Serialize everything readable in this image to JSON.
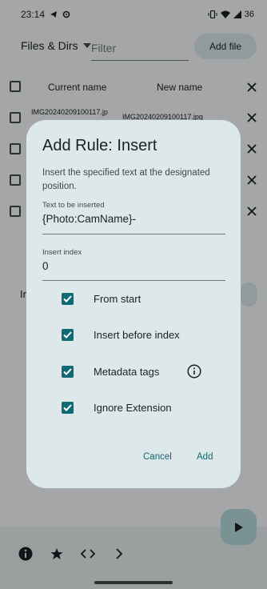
{
  "status_bar": {
    "time": "23:14",
    "battery": "36"
  },
  "toolbar": {
    "files_dropdown": "Files & Dirs",
    "filter_placeholder": "Filter",
    "add_file": "Add file"
  },
  "table": {
    "col_current": "Current name",
    "col_new": "New name",
    "rows": [
      {
        "current": "IMG20240209100117.jp",
        "new": "IMG20240209100117.jpg"
      }
    ]
  },
  "partial_text": "In",
  "dialog": {
    "title": "Add Rule: Insert",
    "description": "Insert the specified text at the designated position.",
    "text_field": {
      "label": "Text to be inserted",
      "value": "{Photo:CamName}-"
    },
    "index_field": {
      "label": "Insert index",
      "value": "0"
    },
    "options": [
      {
        "label": "From start",
        "checked": true
      },
      {
        "label": "Insert before index",
        "checked": true
      },
      {
        "label": "Metadata tags",
        "checked": true
      },
      {
        "label": "Ignore Extension",
        "checked": true
      }
    ],
    "cancel": "Cancel",
    "add": "Add"
  },
  "colors": {
    "accent": "#0f6b73",
    "dialog_bg": "#dde8eb",
    "scrim": "rgba(0,0,0,0.32)"
  }
}
